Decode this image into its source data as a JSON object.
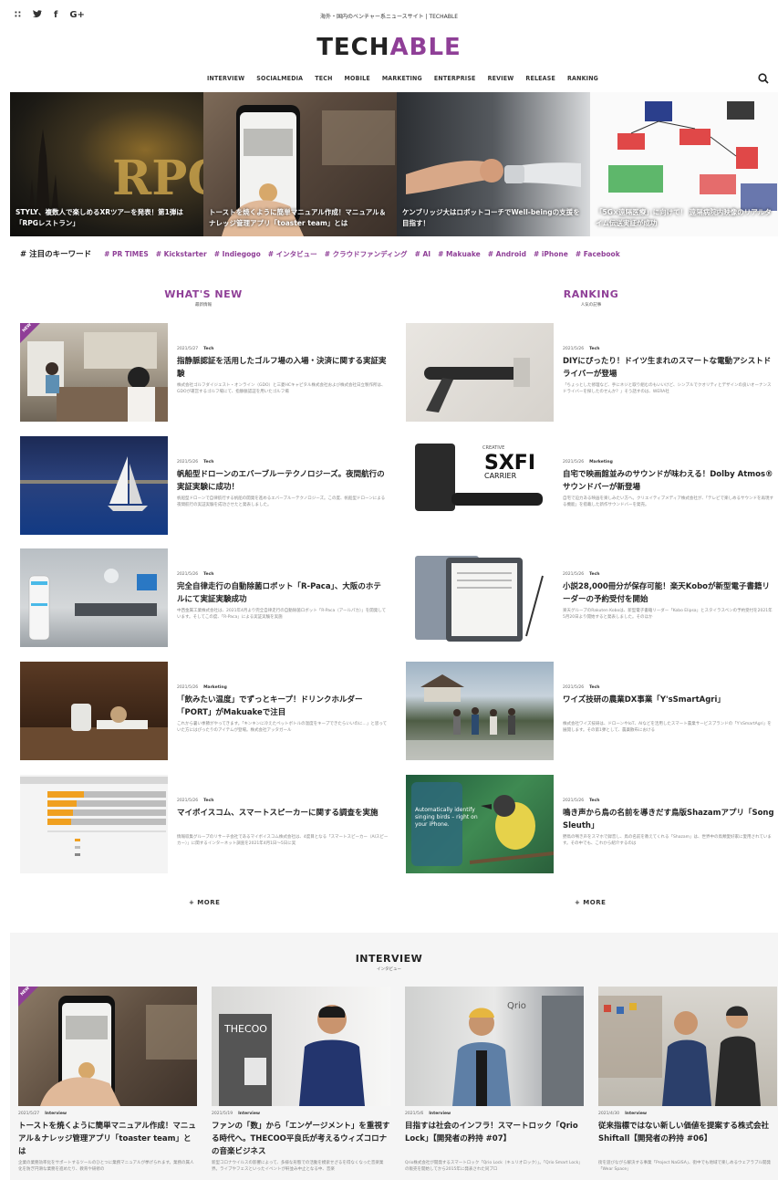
{
  "header": {
    "social": [
      "∷",
      "•",
      "f",
      "G+"
    ],
    "tagline": "海外・国内のベンチャー系ニュースサイト | TECHABLE",
    "logo_left": "TECH",
    "logo_right": "ABLE",
    "nav": [
      "INTERVIEW",
      "SOCIALMEDIA",
      "TECH",
      "MOBILE",
      "MARKETING",
      "ENTERPRISE",
      "REVIEW",
      "RELEASE",
      "RANKING"
    ]
  },
  "hero": [
    {
      "caption": "STYLY、複数人で楽しめるXRツアーを発表！第1弾は「RPGレストラン」"
    },
    {
      "caption": "トーストを焼くように簡単マニュアル作成！マニュアル＆ナレッジ管理アプリ「toaster team」とは"
    },
    {
      "caption": "ケンブリッジ大はロボットコーチでWell-beingの支援を目指す！"
    },
    {
      "caption": "「5G×遠隔医療」に向けて！ 遠隔病院内映像のリアルタイム伝送実証が成功"
    }
  ],
  "keywords": {
    "label": "# 注目のキーワード",
    "tags": [
      "# PR TIMES",
      "# Kickstarter",
      "# Indiegogo",
      "# インタビュー",
      "# クラウドファンディング",
      "# AI",
      "# Makuake",
      "# Android",
      "# iPhone",
      "# Facebook"
    ]
  },
  "whats_new": {
    "title": "WHAT'S NEW",
    "subtitle": "最新情報",
    "badge": "NEW",
    "more": "+ MORE",
    "items": [
      {
        "date": "2021/5/27",
        "cat": "Tech",
        "title": "指静脈認証を活用したゴルフ場の入場・決済に関する実証実験",
        "excerpt": "株式会社ゴルフダイジェスト・オンライン（GDO）と三菱HCキャピタル株式会社および株式会社日立製作所は、GDOが運営するゴルフ場にて、指静脈認証を用いたゴルフ場"
      },
      {
        "date": "2021/5/26",
        "cat": "Tech",
        "title": "帆船型ドローンのエバーブルーテクノロジーズ。夜間航行の実証実験に成功！",
        "excerpt": "帆船型ドローンで自律航行する帆船の開発を進めるエバーブルーテクノロジーズ。この度、帆船型ドローンによる夜間航行の実証実験を成功させたと発表しました。"
      },
      {
        "date": "2021/5/26",
        "cat": "Tech",
        "title": "完全自律走行の自動除菌ロボット「R-Paca」、大阪のホテルにて実証実験成功",
        "excerpt": "中西金属工業株式会社は、2021年4月より完全自律走行の自動除菌ロボット「R-Paca（アールパカ）」を開発しています。そしてこの度、「R-Paca」による実証実験を実施"
      },
      {
        "date": "2021/5/26",
        "cat": "Marketing",
        "title": "「飲みたい温度」でずっとキープ！ドリンクホルダー「PORT」がMakuakeで注目",
        "excerpt": "これから暑い季節がやってきます。「キンキンに冷えたペットボトルの温度をキープできたらいいのに…」と思っていた方にはぴったりのアイテムが登場。株式会社アッタガール"
      },
      {
        "date": "2021/5/26",
        "cat": "Tech",
        "title": "マイボイスコム、スマートスピーカーに関する調査を実施",
        "excerpt": "情報収集グループのリサーチ会社であるマイボイスコム株式会社は、4度目となる「スマートスピーカー（AIスピーカー）」に関するインターネット調査を2021年4月1日〜5日に実"
      }
    ]
  },
  "ranking": {
    "title": "RANKING",
    "subtitle": "人気の記事",
    "more": "+ MORE",
    "items": [
      {
        "date": "2021/5/26",
        "cat": "Tech",
        "title": "DIYにぴったり！ドイツ生まれのスマートな電動アシストドライバーが登場",
        "excerpt": "「ちょっとした修理など、手にネジと取り組むのもいいけど、シンプルでクオリティとデザインの良いオーナンスドライバーを探したのせんか？」そう話すのは、WERA社"
      },
      {
        "date": "2021/5/26",
        "cat": "Marketing",
        "title": "自宅で映画館並みのサウンドが味わえる！Dolby Atmos®サウンドバーが新登場",
        "excerpt": "自宅で迫力ある映画を楽しみたい方へ。クリエイティブメディア株式会社が、「テレビで楽しめるサウンドを再現する機能」を搭載した新作サウンドバーを発売。"
      },
      {
        "date": "2021/5/26",
        "cat": "Tech",
        "title": "小説28,000冊分が保存可能！楽天Koboが新型電子書籍リーダーの予約受付を開始",
        "excerpt": "楽天グループのRakuten Koboは、新型電子書籍リーダー「Kobo Elipsa」とスタイラスペンの予約受付を2021年5月20日より開始すると発表しました。そのほか"
      },
      {
        "date": "2021/5/26",
        "cat": "Tech",
        "title": "ワイズ技研の農業DX事業「Y'sSmartAgri」",
        "excerpt": "株式会社ワイズ技研は、ドローンやIoT、AIなどを活用したスマート農業サービスブランドの「Y'sSmartAgri」を展開します。その第1弾として、農薬散布における"
      },
      {
        "date": "2021/5/26",
        "cat": "Tech",
        "title": "鳴き声から鳥の名前を導きだす鳥版Shazamアプリ「Song Sleuth」",
        "excerpt": "野鳥の鳴き声をスマホで録音し、鳥の名前を教えてくれる「Shazam」は、世界中の鳥類愛好家に愛用されています。その中でも、これから紹介するのは"
      }
    ]
  },
  "interview": {
    "title": "INTERVIEW",
    "subtitle": "インタビュー",
    "badge": "NEW",
    "items": [
      {
        "date": "2021/5/27",
        "cat": "Interview",
        "title": "トーストを焼くように簡単マニュアル作成！マニュアル＆ナレッジ管理アプリ「toaster team」とは",
        "excerpt": "企業の業務効率化をサポートするツールのひとつに業務マニュアルが挙げられます。業務の属人化を防ぎ円滑な業務を進めたり、教育や研修の"
      },
      {
        "date": "2021/5/19",
        "cat": "Interview",
        "title": "ファンの「数」から「エンゲージメント」を重視する時代へ。THECOO平良氏が考えるウィズコロナの音楽ビジネス",
        "excerpt": "新型コロナウイルスの影響によって、多様な形態での活動を模索せざるを得なくなった音楽業界。ライブやフェスといったイベントが軒並み中止となる中、音楽"
      },
      {
        "date": "2021/5/6",
        "cat": "Interview",
        "title": "目指すは社会のインフラ！スマートロック「Qrio Lock」【開発者の矜持 #07】",
        "excerpt": "Qrio株式会社が開発するスマートロック「Qrio Lock（キュリオロック）」。「Qrio Smart Lock」の販売を開始してから2015年に発表された同プロ"
      },
      {
        "date": "2021/4/30",
        "cat": "Interview",
        "title": "従来指標ではない新しい価値を提案する株式会社Shiftall【開発者の矜持 #06】",
        "excerpt": "街を遊びながら解決する事業「Project NaGISA」、街中でも地域で楽しめるウェアラブル開発「Wear Space」"
      }
    ]
  },
  "colors": {
    "accent": "#8f3f97",
    "band": "#f5f5f5"
  }
}
